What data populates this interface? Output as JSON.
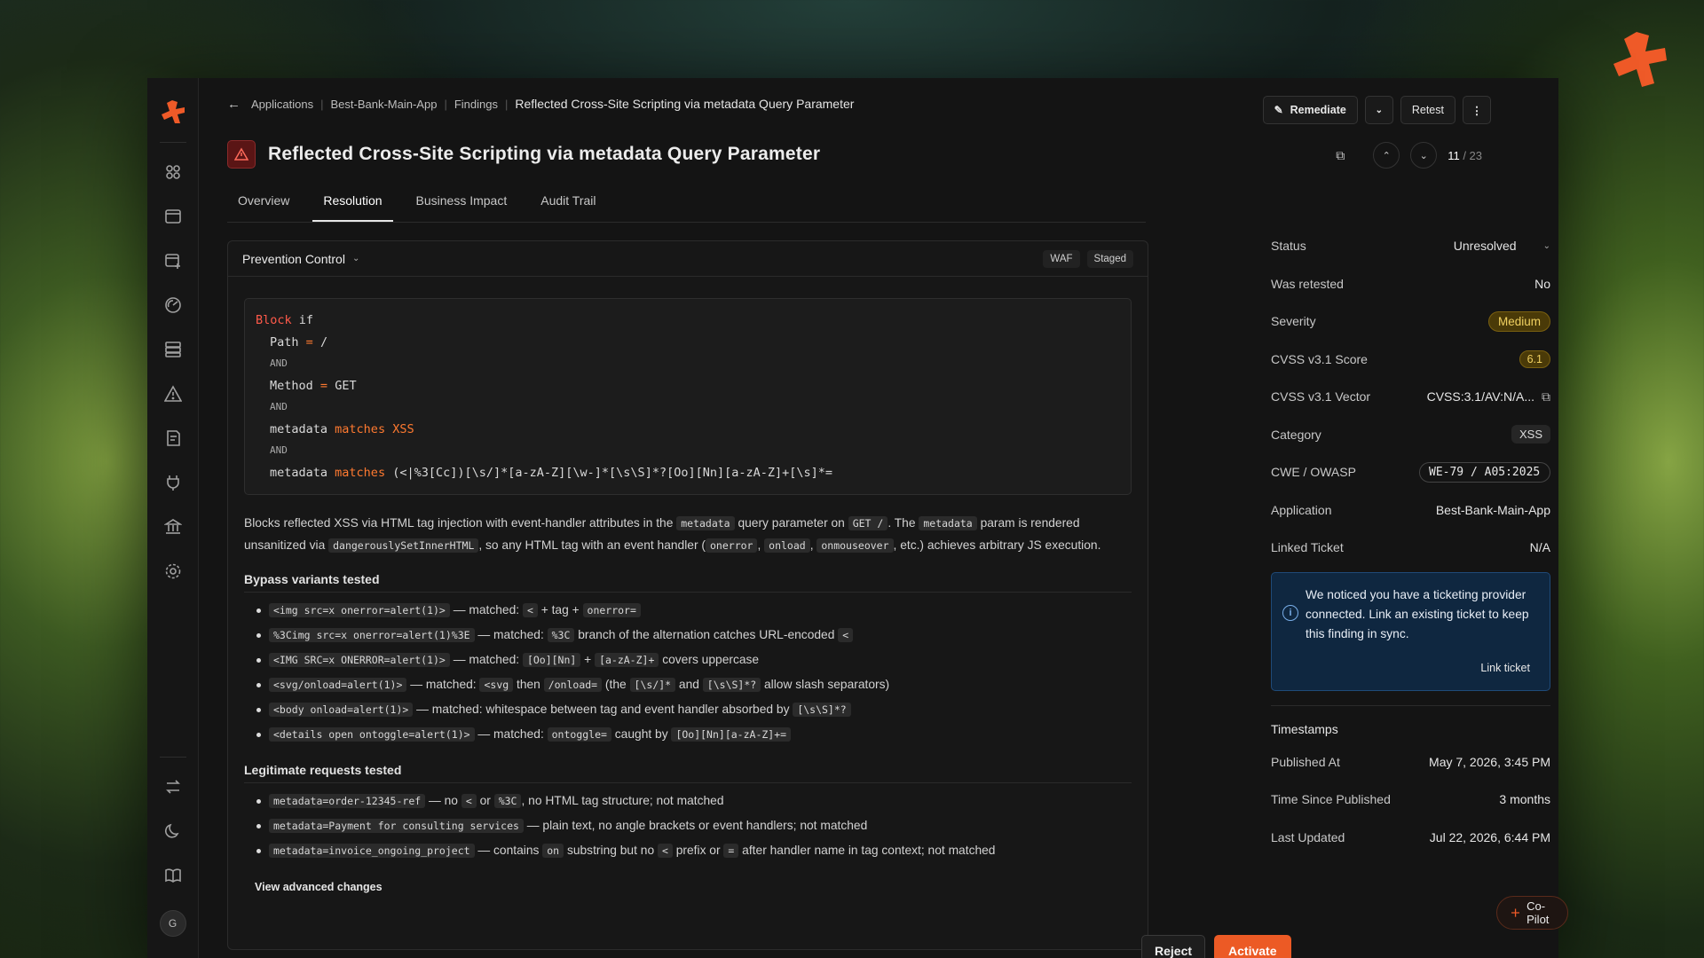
{
  "breadcrumb": {
    "items": [
      "Applications",
      "Best-Bank-Main-App",
      "Findings"
    ],
    "current": "Reflected Cross-Site Scripting via metadata Query Parameter"
  },
  "actions": {
    "remediate": "Remediate",
    "retest": "Retest"
  },
  "title": "Reflected Cross-Site Scripting via metadata Query Parameter",
  "pager": {
    "current": "11",
    "total": "/ 23"
  },
  "tabs": [
    "Overview",
    "Resolution",
    "Business Impact",
    "Audit Trail"
  ],
  "panel": {
    "title": "Prevention Control",
    "tags": [
      "WAF",
      "Staged"
    ],
    "code": {
      "block": "Block",
      "if": "if",
      "path_key": "Path",
      "eq": "=",
      "path_val": "/",
      "and": "AND",
      "method_key": "Method",
      "method_val": "GET",
      "meta_key": "metadata",
      "matches": "matches",
      "xss": "XSS",
      "regex": "(<|%3[Cc])[\\s/]*[a-zA-Z][\\w-]*[\\s\\S]*?[Oo][Nn][a-zA-Z]+[\\s]*="
    },
    "desc": {
      "t1": "Blocks reflected XSS via HTML tag injection with event-handler attributes in the ",
      "c1": "metadata",
      "t2": " query parameter on ",
      "c2": "GET /",
      "t3": ". The ",
      "c3": "metadata",
      "t4": " param is rendered unsanitized via ",
      "c4": "dangerouslySetInnerHTML",
      "t5": ", so any HTML tag with an event handler (",
      "c5": "onerror",
      "t6": ", ",
      "c6": "onload",
      "t7": ", ",
      "c7": "onmouseover",
      "t8": ", etc.) achieves arbitrary JS execution."
    },
    "bypass_title": "Bypass variants tested",
    "bypass": [
      {
        "code": "<img src=x onerror=alert(1)>",
        "t1": " — matched: ",
        "c2": "<",
        "t2": " + tag + ",
        "c3": "onerror="
      },
      {
        "code": "%3Cimg src=x onerror=alert(1)%3E",
        "t1": " — matched: ",
        "c2": "%3C",
        "t2": " branch of the alternation catches URL-encoded ",
        "c3": "<"
      },
      {
        "code": "<IMG SRC=x ONERROR=alert(1)>",
        "t1": " — matched: ",
        "c2": "[Oo][Nn]",
        "t2": " + ",
        "c3": "[a-zA-Z]+",
        "t3": " covers uppercase"
      },
      {
        "code": "<svg/onload=alert(1)>",
        "t1": " — matched: ",
        "c2": "<svg",
        "t2": " then ",
        "c3": "/onload=",
        "t3": " (the ",
        "c4": "[\\s/]*",
        "t4": " and ",
        "c5": "[\\s\\S]*?",
        "t5": " allow slash separators)"
      },
      {
        "code": "<body onload=alert(1)>",
        "t1": " — matched: whitespace between tag and event handler absorbed by ",
        "c2": "[\\s\\S]*?"
      },
      {
        "code": "<details open ontoggle=alert(1)>",
        "t1": " — matched: ",
        "c2": "ontoggle=",
        "t2": " caught by ",
        "c3": "[Oo][Nn][a-zA-Z]+="
      }
    ],
    "legit_title": "Legitimate requests tested",
    "legit": [
      {
        "code": "metadata=order-12345-ref",
        "t1": " — no ",
        "c2": "<",
        "t2": " or ",
        "c3": "%3C",
        "t3": ", no HTML tag structure; not matched"
      },
      {
        "code": "metadata=Payment for consulting services",
        "t1": " — plain text, no angle brackets or event handlers; not matched"
      },
      {
        "code": "metadata=invoice_ongoing_project",
        "t1": " — contains ",
        "c2": "on",
        "t2": " substring but no ",
        "c3": "<",
        "t3": " prefix or ",
        "c4": "=",
        "t4": " after handler name in tag context; not matched"
      }
    ],
    "advanced": "View advanced changes",
    "reject": "Reject",
    "activate": "Activate"
  },
  "side": {
    "status_k": "Status",
    "status_v": "Unresolved",
    "retested_k": "Was retested",
    "retested_v": "No",
    "severity_k": "Severity",
    "severity_v": "Medium",
    "cvss_k": "CVSS v3.1 Score",
    "cvss_v": "6.1",
    "vector_k": "CVSS v3.1 Vector",
    "vector_v": "CVSS:3.1/AV:N/A...",
    "category_k": "Category",
    "category_v": "XSS",
    "cwe_k": "CWE / OWASP",
    "cwe_v": "WE-79 / A05:2025",
    "app_k": "Application",
    "app_v": "Best-Bank-Main-App",
    "ticket_k": "Linked Ticket",
    "ticket_v": "N/A",
    "info_text": "We noticed you have a ticketing provider connected. Link an existing ticket to keep this finding in sync.",
    "link_ticket": "Link ticket",
    "timestamps_title": "Timestamps",
    "published_k": "Published At",
    "published_v": "May 7, 2026, 3:45 PM",
    "since_k": "Time Since Published",
    "since_v": "3 months",
    "updated_k": "Last Updated",
    "updated_v": "Jul 22, 2026, 6:44 PM"
  },
  "copilot": "Co-Pilot",
  "avatar": "G",
  "colors": {
    "accent": "#ec5a25",
    "severity_medium": "#f0d060",
    "info_blue": "#0f2740"
  }
}
